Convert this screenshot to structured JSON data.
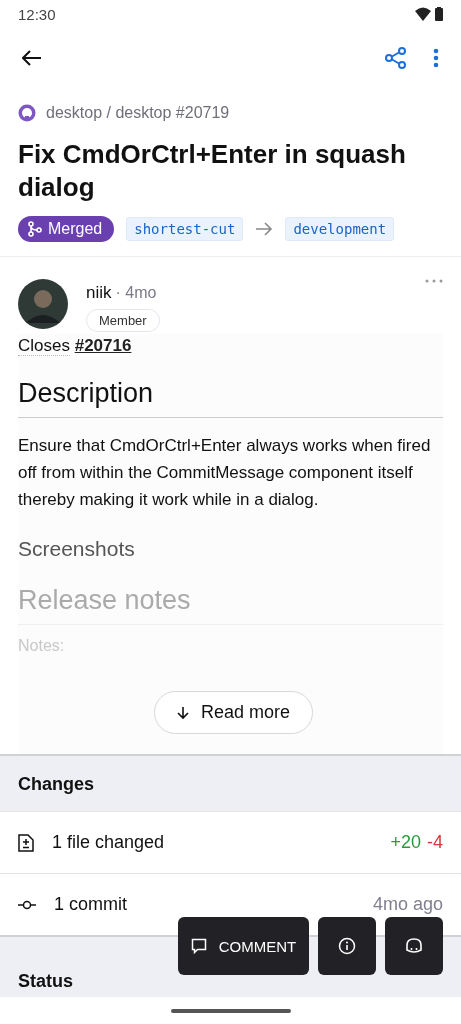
{
  "status_bar": {
    "time": "12:30"
  },
  "repo": {
    "path": "desktop / desktop #20719"
  },
  "title": "Fix CmdOrCtrl+Enter in squash dialog",
  "state": {
    "label": "Merged",
    "kind": "merged"
  },
  "branches": {
    "head": "shortest-cut",
    "base": "development"
  },
  "author": {
    "name": "niik",
    "separator": "·",
    "age": "4mo",
    "role": "Member"
  },
  "body": {
    "closes_label": "Closes",
    "closes_ref": "#20716",
    "heading": "Description",
    "paragraph": "Ensure that CmdOrCtrl+Enter always works when fired off from within the CommitMessage component itself thereby making it work while in a dialog.",
    "subheading": "Screenshots",
    "faded_heading": "Release notes",
    "faded_text": "Notes:"
  },
  "read_more": "Read more",
  "changes": {
    "title": "Changes",
    "rows": [
      {
        "kind": "files",
        "label": "1 file changed",
        "additions": "+20",
        "deletions": "-4"
      },
      {
        "kind": "commits",
        "label": "1 commit",
        "time": "4mo ago"
      }
    ]
  },
  "status_section": {
    "title": "Status"
  },
  "actions": {
    "comment": "COMMENT"
  }
}
